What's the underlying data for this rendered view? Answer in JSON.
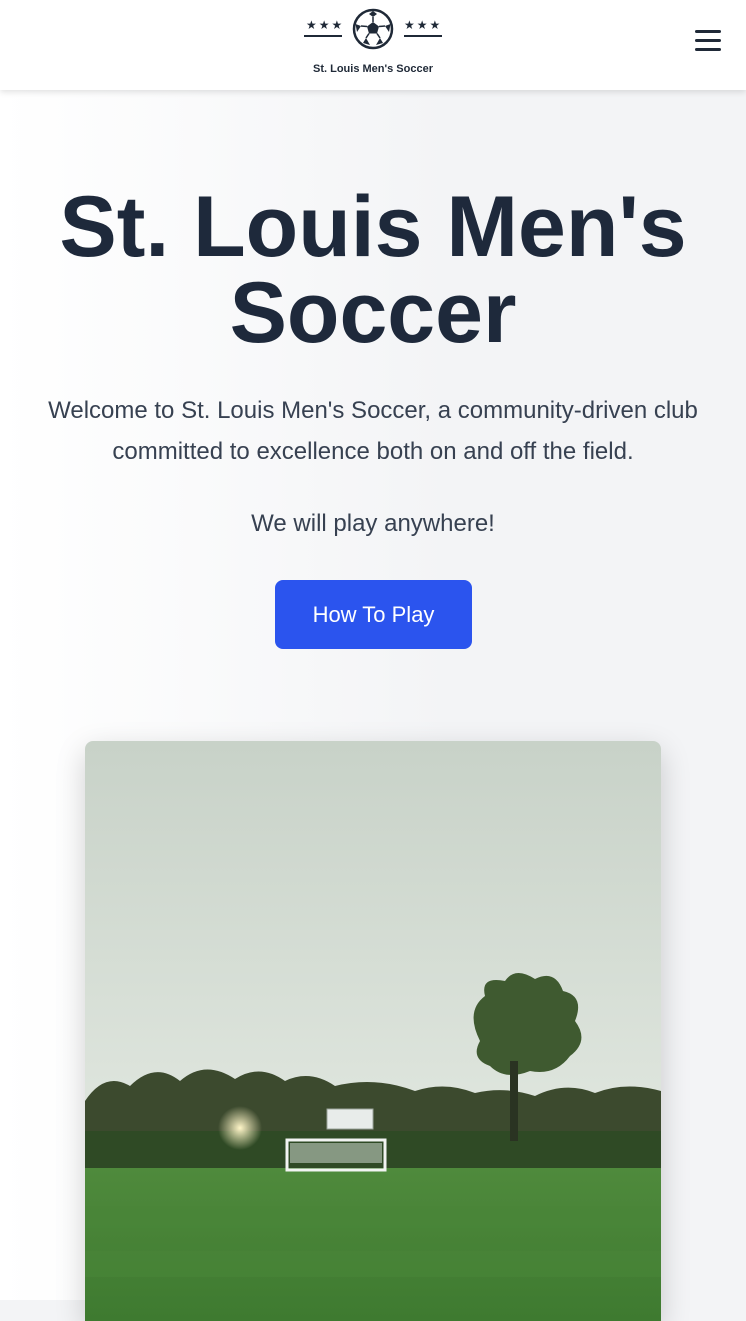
{
  "header": {
    "logo": {
      "stars": "★★★",
      "text": "St. Louis Men's Soccer",
      "icon": "soccer-ball-icon"
    },
    "menu_icon": "hamburger-menu-icon"
  },
  "hero": {
    "title": "St. Louis Men's Soccer",
    "intro": "Welcome to St. Louis Men's Soccer, a community-driven club committed to excellence both on and off the field.",
    "tagline": "We will play anywhere!",
    "cta_label": "How To Play",
    "image_subject": "soccer-field-with-goal-and-trees"
  },
  "colors": {
    "primary_button": "#2b54ee",
    "heading": "#1e293b",
    "body_text": "#374151",
    "page_background": "#f3f4f6"
  }
}
